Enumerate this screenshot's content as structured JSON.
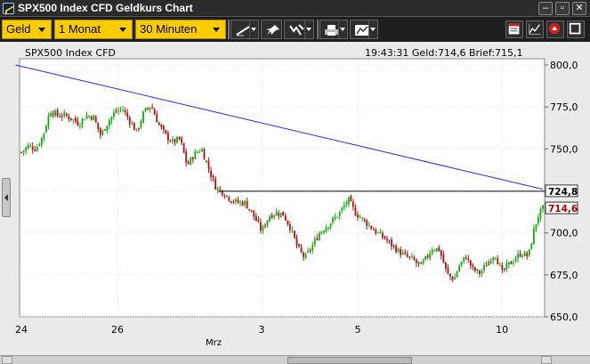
{
  "window": {
    "title": "SPX500 Index CFD Geldkurs Chart"
  },
  "toolbar": {
    "price_type": "Geld",
    "period": "1 Monat",
    "interval": "30 Minuten",
    "icons": [
      "draw-line-icon",
      "pin-icon",
      "indicator-icon",
      "print-icon",
      "chart-type-icon"
    ],
    "right_icons": [
      "layout-icon",
      "line-chart-icon",
      "alarm-icon",
      "maximize-icon"
    ]
  },
  "chart_header": {
    "instrument": "SPX500 Index CFD",
    "time": "19:43:31",
    "bid_label": "Geld:",
    "bid": "714,6",
    "ask_label": "Brief:",
    "ask": "715,1"
  },
  "colors": {
    "candle_up": "#11aa11",
    "candle_down": "#aa1111",
    "trendline": "#2a2ad0",
    "price_tag_text": "#aa0000"
  },
  "chart_data": {
    "type": "candlestick",
    "y_ticks": [
      "800,0",
      "775,0",
      "750,0",
      "725,0",
      "700,0",
      "675,0",
      "650,0"
    ],
    "ylim": [
      650,
      800
    ],
    "x_ticks": [
      {
        "label": "24",
        "day": 0
      },
      {
        "label": "26",
        "day": 2
      },
      {
        "label": "3",
        "day": 5
      },
      {
        "label": "5",
        "day": 7
      },
      {
        "label": "10",
        "day": 10
      }
    ],
    "month_label": {
      "label": "Mrz",
      "day": 4
    },
    "x_range_days": [
      0,
      10.85
    ],
    "trendline": {
      "from": {
        "day": -0.12,
        "value": 800
      },
      "to": {
        "day": 10.85,
        "value": 726
      }
    },
    "horizontal_line": {
      "from_day": 4.1,
      "value": 724.8
    },
    "price_tags": [
      "724,8",
      "714,6"
    ],
    "close_path": [
      [
        0.0,
        748
      ],
      [
        0.15,
        752
      ],
      [
        0.3,
        750
      ],
      [
        0.45,
        758
      ],
      [
        0.6,
        773
      ],
      [
        0.75,
        770
      ],
      [
        0.9,
        770
      ],
      [
        1.05,
        768
      ],
      [
        1.2,
        765
      ],
      [
        1.35,
        770
      ],
      [
        1.5,
        769
      ],
      [
        1.65,
        758
      ],
      [
        1.8,
        766
      ],
      [
        1.95,
        772
      ],
      [
        2.1,
        774
      ],
      [
        2.25,
        767
      ],
      [
        2.4,
        760
      ],
      [
        2.55,
        772
      ],
      [
        2.7,
        776
      ],
      [
        2.85,
        765
      ],
      [
        3.0,
        758
      ],
      [
        3.15,
        754
      ],
      [
        3.3,
        756
      ],
      [
        3.45,
        740
      ],
      [
        3.6,
        747
      ],
      [
        3.75,
        750
      ],
      [
        3.9,
        738
      ],
      [
        4.05,
        727
      ],
      [
        4.2,
        724
      ],
      [
        4.35,
        720
      ],
      [
        4.5,
        718
      ],
      [
        4.65,
        718
      ],
      [
        4.8,
        712
      ],
      [
        5.0,
        701
      ],
      [
        5.15,
        710
      ],
      [
        5.3,
        712
      ],
      [
        5.45,
        711
      ],
      [
        5.6,
        703
      ],
      [
        5.75,
        691
      ],
      [
        5.9,
        685
      ],
      [
        6.05,
        692
      ],
      [
        6.2,
        700
      ],
      [
        6.35,
        704
      ],
      [
        6.5,
        708
      ],
      [
        6.65,
        713
      ],
      [
        6.8,
        720
      ],
      [
        6.95,
        712
      ],
      [
        7.1,
        708
      ],
      [
        7.25,
        704
      ],
      [
        7.4,
        700
      ],
      [
        7.55,
        697
      ],
      [
        7.7,
        693
      ],
      [
        7.85,
        689
      ],
      [
        8.0,
        686
      ],
      [
        8.15,
        684
      ],
      [
        8.3,
        680
      ],
      [
        8.45,
        686
      ],
      [
        8.55,
        691
      ],
      [
        8.7,
        690
      ],
      [
        8.85,
        676
      ],
      [
        9.0,
        672
      ],
      [
        9.1,
        680
      ],
      [
        9.25,
        686
      ],
      [
        9.4,
        678
      ],
      [
        9.55,
        676
      ],
      [
        9.7,
        682
      ],
      [
        9.85,
        688
      ],
      [
        10.0,
        676
      ],
      [
        10.1,
        680
      ],
      [
        10.25,
        684
      ],
      [
        10.4,
        688
      ],
      [
        10.55,
        686
      ],
      [
        10.65,
        700
      ],
      [
        10.75,
        710
      ],
      [
        10.85,
        714.6
      ]
    ]
  }
}
